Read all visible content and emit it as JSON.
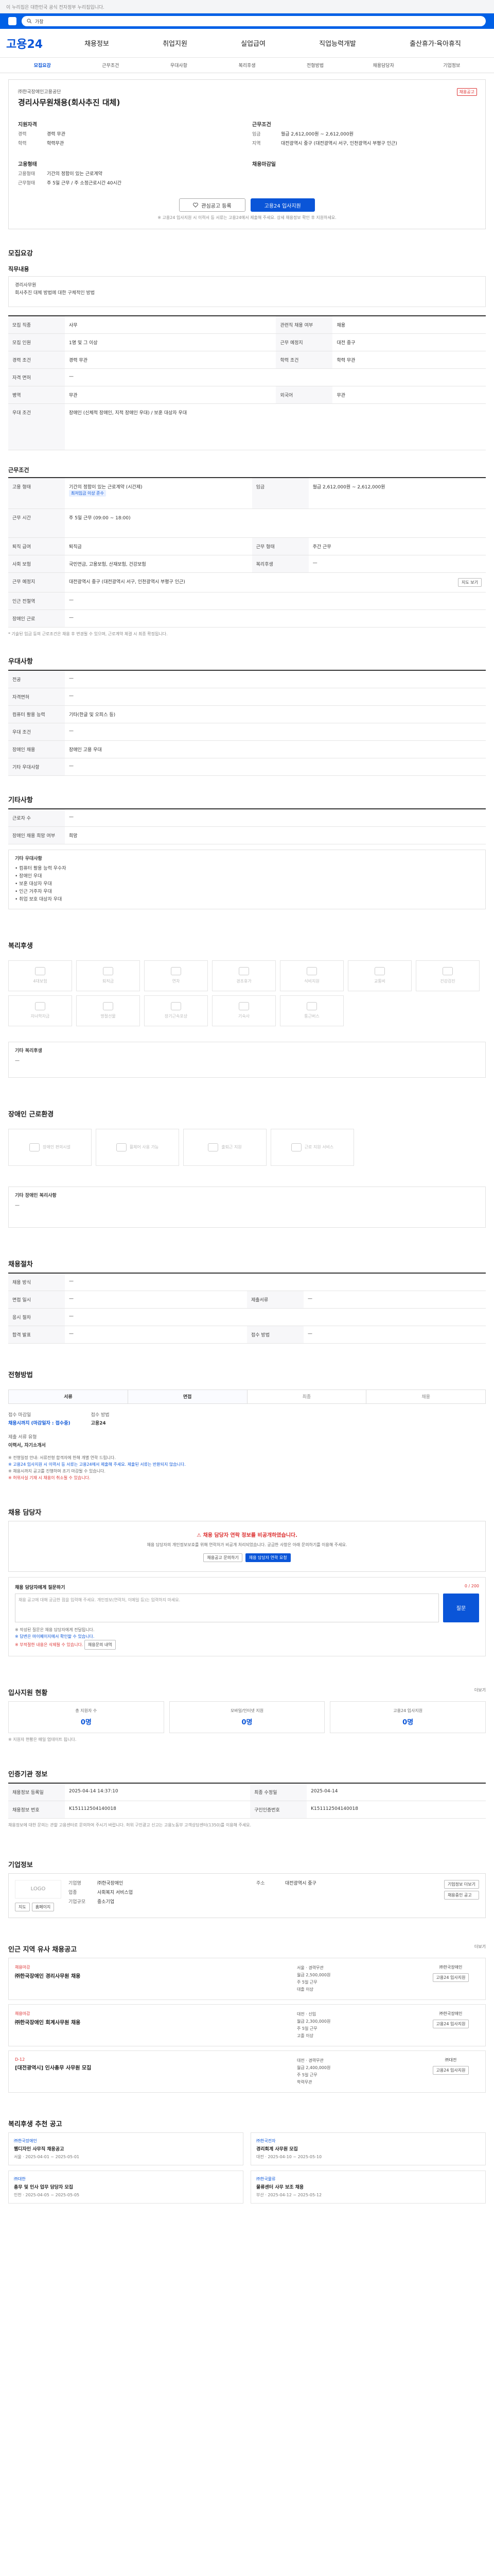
{
  "topbar": {
    "notice": "이 누리집은 대한민국 공식 전자정부 누리집입니다."
  },
  "search": {
    "placeholder": "가창"
  },
  "header": {
    "brand": "고용24",
    "gnb": [
      "채용정보",
      "취업지원",
      "실업급여",
      "직업능력개발",
      "출산휴가·육아휴직"
    ]
  },
  "subnav": [
    "모집요강",
    "근무조건",
    "우대사항",
    "복리후생",
    "전형방법",
    "채용담당자",
    "기업정보"
  ],
  "job": {
    "company": "㈜한국장애인고용공단",
    "title": "경리사무원채용(회사추진 대체)",
    "badge": "채용공고",
    "left_title": "지원자격",
    "left_rows": [
      {
        "k": "경력",
        "v": "경력 무관"
      },
      {
        "k": "학력",
        "v": "학력무관"
      }
    ],
    "left_title2": "고용형태",
    "left_rows2": [
      {
        "k": "고용형태",
        "v": "기간의 정함이 있는 근로계약"
      },
      {
        "k": "근무형태",
        "v": "주 5일 근무 / 주 소정근로시간 40시간"
      }
    ],
    "right_title": "근무조건",
    "right_rows": [
      {
        "k": "임금",
        "v": "월급 2,612,000원 ~ 2,612,000원"
      },
      {
        "k": "지역",
        "v": "대전광역시 중구 (대전광역시 서구, 인천광역시 부평구 인근)"
      }
    ],
    "right_title2": "채용마감일",
    "btn_interest": "관심공고 등록",
    "btn_apply": "고용24 입사지원",
    "apply_note": "※ 고용24 입사지원 시 이력서 등 서류는 고용24에서 제출해 주세요. 상세 채용정보 확인 후 지원하세요."
  },
  "recruit": {
    "heading": "모집요강",
    "h_job": "직무내용",
    "job_desc": "경리사무원\n회사추진 대체 방법에 대한 구체적인 방법",
    "rows": [
      {
        "k": "모집 직종",
        "v": "사무",
        "k2": "관련직 채용 여부",
        "v2": "채용"
      },
      {
        "k": "모집 인원",
        "v": "1명 및 그 이상",
        "k2": "근무 예정지",
        "v2": "대전 중구"
      },
      {
        "k": "경력 조건",
        "v": "경력 무관",
        "k2": "학력 조건",
        "v2": "학력 무관"
      },
      {
        "k": "자격 면허",
        "v": "—",
        "k2": "",
        "v2": ""
      },
      {
        "k": "병역",
        "v": "무관",
        "k2": "외국어",
        "v2": "무관"
      },
      {
        "k": "우대 조건",
        "v": "장애인 (신체적 장애인, 지적 장애인 우대) / 보훈 대상자 우대",
        "k2": "",
        "v2": ""
      }
    ],
    "h_cond": "근무조건",
    "cond_rows": [
      {
        "k": "고용 형태",
        "v": "기간의 정함이 있는 근로계약 (시간제)",
        "k2": "임금",
        "v2": "월급 2,612,000원 ~ 2,612,000원"
      },
      {
        "k": "근무 시간",
        "v": "주 5일 근무 (09:00 ~ 18:00)",
        "k2": "",
        "v2": ""
      },
      {
        "k": "퇴직 급여",
        "v": "퇴직금",
        "k2": "근무 형태",
        "v2": "주간 근무"
      },
      {
        "k": "사회 보험",
        "v": "국민연금, 고용보험, 산재보험, 건강보험",
        "k2": "복리후생",
        "v2": "—"
      },
      {
        "k": "근무 예정지",
        "v": "대전광역시 중구 (대전광역시 서구, 인천광역시 부평구 인근)",
        "k2": "",
        "v2": ""
      },
      {
        "k": "인근 전철역",
        "v": "—",
        "k2": "",
        "v2": ""
      },
      {
        "k": "장애인 근로",
        "v": "—",
        "k2": "",
        "v2": ""
      }
    ],
    "wage_badge": "최저임금 이상 준수",
    "map_btn": "지도 보기",
    "footnote": "* 기술된 임금 등의 근로조건은 채용 후 변경될 수 있으며, 근로계약 체결 시 최종 확정됩니다."
  },
  "pref": {
    "heading": "우대사항",
    "rows": [
      {
        "k": "전공",
        "v": "—"
      },
      {
        "k": "자격면허",
        "v": "—"
      },
      {
        "k": "컴퓨터 활용 능력",
        "v": "기타(한글 및 오피스 등)"
      },
      {
        "k": "우대 조건",
        "v": "—"
      },
      {
        "k": "장애인 채용",
        "v": "장애인 고용 우대"
      },
      {
        "k": "기타 우대사항",
        "v": "—"
      }
    ]
  },
  "etc": {
    "heading": "기타사항",
    "rows": [
      {
        "k": "근로자 수",
        "v": "—"
      },
      {
        "k": "장애인 채용 희망 여부",
        "v": "희망"
      }
    ],
    "sub": "기타 우대사항",
    "list": [
      "컴퓨터 활용 능력 우수자",
      "장애인 우대",
      "보훈 대상자 우대",
      "인근 거주자 우대",
      "취업 보호 대상자 우대"
    ]
  },
  "welfare": {
    "heading": "복리후생",
    "items": [
      "4대보험",
      "퇴직금",
      "연차",
      "경조휴가",
      "식비지원",
      "교통비",
      "건강검진",
      "자녀학자금",
      "명절선물",
      "장기근속포상",
      "기숙사",
      "통근버스"
    ],
    "sub": "기타 복리후생",
    "sub_val": "—"
  },
  "disability": {
    "heading": "장애인 근로환경",
    "items": [
      "장애인 편의시설",
      "휠체어 사용 가능",
      "출퇴근 지원",
      "근로 지원 서비스"
    ],
    "sub": "기타 장애인 복리사항",
    "sub_val": "—"
  },
  "hire": {
    "heading": "채용절차",
    "rows": [
      {
        "k": "채용 방식",
        "v": "—"
      },
      {
        "k": "면접 일시",
        "v": "—",
        "k2": "제출서류",
        "v2": "—"
      },
      {
        "k": "응시 절차",
        "v": "—"
      },
      {
        "k": "합격 발표",
        "v": "—",
        "k2": "접수 방법",
        "v2": "—"
      }
    ]
  },
  "process": {
    "heading": "전형방법",
    "steps": [
      "서류",
      "면접",
      "최종",
      "채용"
    ],
    "recv_label": "접수 마감일",
    "recv_val": "채용시까지 (마감일자 : 접수중)",
    "method_label": "접수 방법",
    "method_val": "고용24",
    "doc_label": "제출 서류 유형",
    "doc_val": "이력서, 자기소개서",
    "bullets": [
      "※ 전형일정 안내: 서류전형 합격자에 한해 개별 연락 드립니다.",
      "※ 고용24 입사지원 시 이력서 등 서류는 고용24에서 제출해 주세요. 제출된 서류는 반환되지 않습니다.",
      "※ 채용시까지 공고를 진행하며 조기 마감될 수 있습니다.",
      "※ 허위사실 기재 시 채용이 취소될 수 있습니다."
    ]
  },
  "contact": {
    "heading": "채용 담당자",
    "alert": "채용 담당자 연락 정보를 비공개하였습니다.",
    "alert_desc": "채용 담당자의 개인정보보호를 위해 연락처가 비공개 처리되었습니다. 궁금한 사항은 아래 문의하기를 이용해 주세요.",
    "btn1": "채용공고 문의하기",
    "btn2": "채용 담당자 연락 요청",
    "q_title": "채용 담당자에게 질문하기",
    "q_count": "0 / 200",
    "q_placeholder": "채용 공고에 대해 궁금한 점을 입력해 주세요. 개인정보(연락처, 이메일 등)는 입력하지 마세요.",
    "q_btn": "질문",
    "q_note1": "※ 작성된 질문은 채용 담당자에게 전달됩니다.",
    "q_note2": "※ 답변은 마이페이지에서 확인할 수 있습니다.",
    "q_note3": "※ 부적절한 내용은 삭제될 수 있습니다.",
    "q_more": "채용문의 내역"
  },
  "stats": {
    "heading": "입사지원 현황",
    "more": "더보기",
    "cards": [
      {
        "l": "총 지원자 수",
        "n": "0명"
      },
      {
        "l": "모바일/인터넷 지원",
        "n": "0명"
      },
      {
        "l": "고용24 입사지원",
        "n": "0명"
      }
    ],
    "note": "※ 지원자 현황은 매일 업데이트 됩니다."
  },
  "info": {
    "heading": "인증기관 정보",
    "rows": [
      {
        "k": "채용정보 등록일",
        "v": "2025-04-14 14:37:10",
        "k2": "최종 수정일",
        "v2": "2025-04-14"
      },
      {
        "k": "채용정보 번호",
        "v": "K151112504140018",
        "k2": "구인인증번호",
        "v2": "K151112504140018"
      }
    ],
    "note": "채용정보에 대한 문의는 관할 고용센터로 문의하여 주시기 바랍니다. 허위 구인광고 신고는 고용노동부 고객상담센터(1350)를 이용해 주세요."
  },
  "company": {
    "heading": "기업정보",
    "logo": "LOGO",
    "name_k": "기업명",
    "name_v": "㈜한국장애인",
    "type_k": "업종",
    "type_v": "사회복지 서비스업",
    "size_k": "기업규모",
    "size_v": "중소기업",
    "addr_k": "주소",
    "addr_v": "대전광역시 중구",
    "btn_more": "기업정보 더보기",
    "btn_jobs": "채용중인 공고",
    "btn_map": "지도",
    "btn_home": "홈페이지"
  },
  "similar": {
    "heading": "인근 지역 유사 채용공고",
    "more": "더보기",
    "jobs": [
      {
        "org": "채용마감",
        "title": "㈜한국장애인 경리사무원 채용",
        "mid": [
          "서울 · 경력무관",
          "월급 2,500,000원",
          "주 5일 근무",
          "대졸 이상"
        ],
        "who": "㈜한국장애인"
      },
      {
        "org": "채용마감",
        "title": "㈜한국장애인 회계사무원 채용",
        "mid": [
          "대전 · 신입",
          "월급 2,300,000원",
          "주 5일 근무",
          "고졸 이상"
        ],
        "who": "㈜한국장애인"
      },
      {
        "org": "D-12",
        "title": "[대전광역시] 인사총무 사무원 모집",
        "mid": [
          "대전 · 경력무관",
          "월급 2,400,000원",
          "주 5일 근무",
          "학력무관"
        ],
        "who": "㈜대전"
      }
    ]
  },
  "recommend": {
    "heading": "복리후생 추천 공고",
    "cards": [
      {
        "org": "㈜한국장애인",
        "title": "웹디자인 사무직 채용공고",
        "meta": "서울 · 2025-04-01 ~ 2025-05-01"
      },
      {
        "org": "㈜한국전자",
        "title": "경리회계 사무원 모집",
        "meta": "대전 · 2025-04-10 ~ 2025-05-10"
      },
      {
        "org": "㈜대한",
        "title": "총무 및 인사 업무 담당자 모집",
        "meta": "인천 · 2025-04-05 ~ 2025-05-05"
      },
      {
        "org": "㈜한국물류",
        "title": "물류센터 사무 보조 채용",
        "meta": "부산 · 2025-04-12 ~ 2025-05-12"
      }
    ]
  }
}
